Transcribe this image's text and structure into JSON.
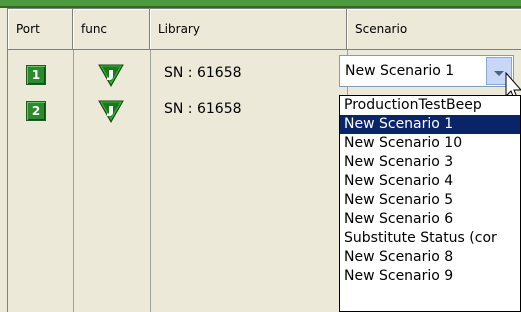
{
  "table": {
    "columns": [
      "Port",
      "func",
      "Library",
      "Scenario"
    ],
    "rows": [
      {
        "port": "1",
        "func_icon": "download-icon",
        "library": "SN : 61658",
        "scenario": "New Scenario 1"
      },
      {
        "port": "2",
        "func_icon": "download-icon",
        "library": "SN : 61658",
        "scenario": ""
      }
    ]
  },
  "dropdown": {
    "selected_index": 1,
    "options": [
      "ProductionTestBeep",
      "New Scenario 1",
      "New Scenario 10",
      "New Scenario 3",
      "New Scenario 4",
      "New Scenario 5",
      "New Scenario 6",
      "Substitute Status (cor",
      "New Scenario 8",
      "New Scenario 9"
    ]
  },
  "colors": {
    "port_badge": "#2c8a2c",
    "func_icon": "#1a7a1a",
    "selected_highlight": "#0a246a",
    "top_strip": "#4f9a3f"
  }
}
